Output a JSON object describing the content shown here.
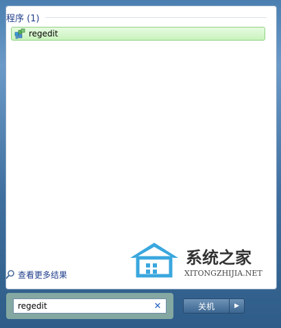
{
  "results": {
    "section_title": "程序 (1)",
    "items": [
      {
        "label": "regedit",
        "icon": "registry-editor-icon"
      }
    ]
  },
  "see_more": {
    "label": "查看更多结果",
    "icon": "search-icon"
  },
  "search": {
    "value": "regedit",
    "clear_icon": "close-icon"
  },
  "shutdown": {
    "label": "关机",
    "arrow_icon": "triangle-right-icon"
  },
  "watermark": {
    "text_cn": "系统之家",
    "text_en": "XITONGZHIJIA.NET"
  },
  "colors": {
    "highlight": "#c9f3bd",
    "link": "#1e3c8a"
  }
}
